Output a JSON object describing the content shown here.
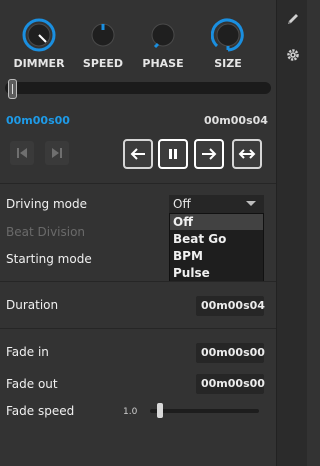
{
  "knobs": [
    {
      "label": "DIMMER",
      "accent": "#1a8fe0"
    },
    {
      "label": "SPEED",
      "accent": "#1a8fe0"
    },
    {
      "label": "PHASE",
      "accent": "#1a8fe0"
    },
    {
      "label": "SIZE",
      "accent": "#1a8fe0"
    }
  ],
  "timeline": {
    "current": "00m00s00",
    "total": "00m00s04"
  },
  "transport": {
    "prev_icon": "skip-previous-icon",
    "next_icon": "skip-next-icon",
    "backward_icon": "arrow-left-icon",
    "pause_icon": "pause-icon",
    "forward_icon": "arrow-right-icon",
    "pingpong_icon": "arrow-both-icon"
  },
  "driving_mode": {
    "label": "Driving mode",
    "value": "Off",
    "options": [
      "Off",
      "Beat Go",
      "BPM",
      "Pulse"
    ]
  },
  "beat_division": {
    "label": "Beat Division"
  },
  "starting_mode": {
    "label": "Starting mode"
  },
  "duration": {
    "label": "Duration",
    "value": "00m00s04"
  },
  "fade_in": {
    "label": "Fade in",
    "value": "00m00s00"
  },
  "fade_out": {
    "label": "Fade out",
    "value": "00m00s00"
  },
  "fade_speed": {
    "label": "Fade speed",
    "value": "1.0"
  },
  "sidebar": {
    "edit_icon": "pencil-icon",
    "settings_icon": "gear-icon"
  }
}
